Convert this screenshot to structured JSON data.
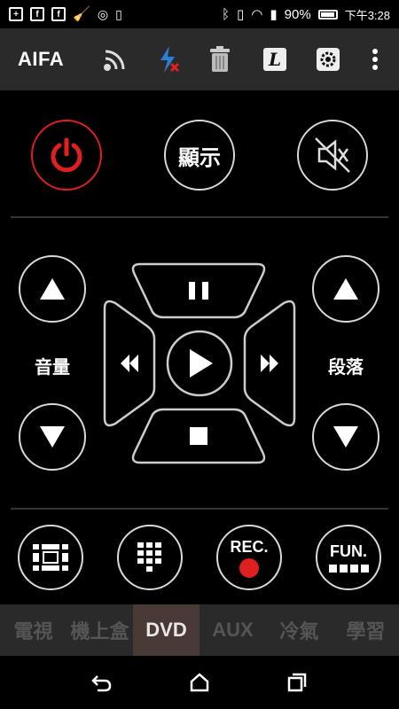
{
  "status_bar": {
    "battery": "90%",
    "time": "下午3:28"
  },
  "app_bar": {
    "title": "AIFA",
    "icons": [
      "wifi-signal-icon",
      "flash-off-icon",
      "trash-icon",
      "L-box-icon",
      "settings-gear-icon",
      "more-vert-icon"
    ],
    "l_label": "L"
  },
  "top_row": {
    "power": "power-icon",
    "display_label": "顯示",
    "mute": "mute-icon"
  },
  "left_side": {
    "label": "音量"
  },
  "right_side": {
    "label": "段落"
  },
  "bottom_row": {
    "rec_label": "REC.",
    "fun_label": "FUN."
  },
  "tabs": [
    {
      "label": "電視",
      "active": false
    },
    {
      "label": "機上盒",
      "active": false
    },
    {
      "label": "DVD",
      "active": true
    },
    {
      "label": "AUX",
      "active": false
    },
    {
      "label": "冷氣",
      "active": false
    },
    {
      "label": "學習",
      "active": false
    }
  ],
  "colors": {
    "accent_red": "#e02020",
    "appbar_bg": "#2a2a2a",
    "active_tab": "#4a3a35"
  }
}
